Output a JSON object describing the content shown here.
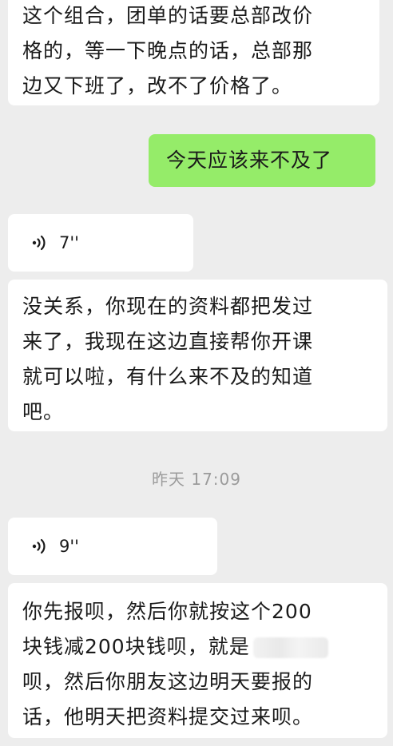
{
  "messages": [
    {
      "side": "left",
      "type": "text",
      "lines": [
        "这个组合，团单的话要总部改价",
        "格的，等一下晚点的话，总部那",
        "边又下班了，改不了价格了。"
      ]
    },
    {
      "side": "right",
      "type": "text",
      "lines": [
        "今天应该来不及了"
      ]
    },
    {
      "side": "left",
      "type": "voice",
      "duration": "7''",
      "icon": "voice-wave-icon"
    },
    {
      "side": "left",
      "type": "text",
      "lines": [
        "没关系，你现在的资料都把发过",
        "来了，我现在这边直接帮你开课",
        "就可以啦，有什么来不及的知道",
        "吧。"
      ]
    },
    {
      "type": "timestamp",
      "text": "昨天 17:09"
    },
    {
      "side": "left",
      "type": "voice",
      "duration": "9''",
      "icon": "voice-wave-icon"
    },
    {
      "side": "left",
      "type": "text",
      "lines": [
        "你先报呗，然后你就按这个200",
        "块钱减200块钱呗，就是",
        "呗，然后你朋友这边明天要报的",
        "话，他明天把资料提交过来呗。"
      ]
    }
  ],
  "colors": {
    "background": "#ededed",
    "incoming_bubble": "#ffffff",
    "outgoing_bubble": "#95ec69",
    "timestamp_text": "#9b9b9b"
  }
}
